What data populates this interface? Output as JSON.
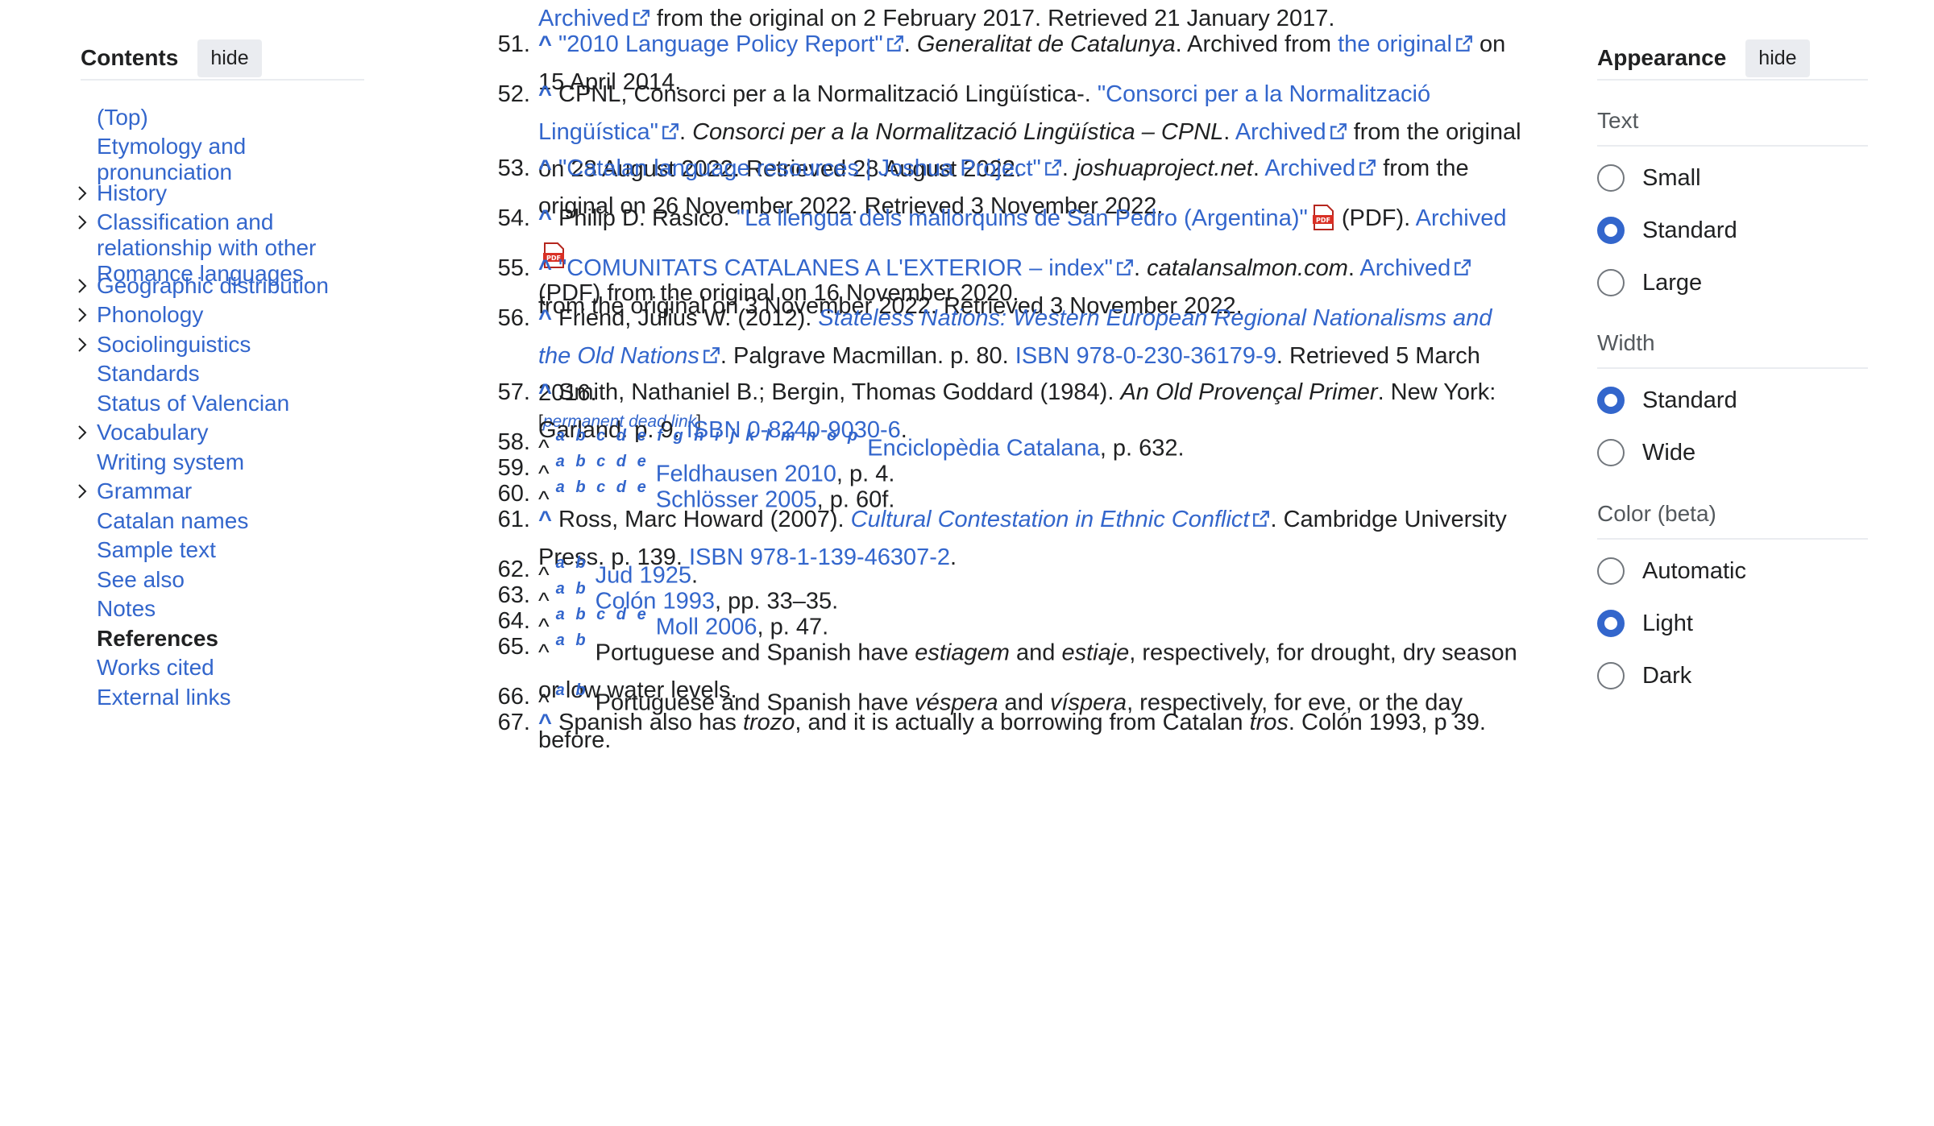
{
  "toc": {
    "title": "Contents",
    "hide_label": "hide",
    "items": [
      {
        "label": "(Top)"
      },
      {
        "label": "Etymology and pronunciation"
      },
      {
        "label": "History"
      },
      {
        "label": "Classification and relationship with other Romance languages"
      },
      {
        "label": "Geographic distribution"
      },
      {
        "label": "Phonology"
      },
      {
        "label": "Sociolinguistics"
      },
      {
        "label": "Standards"
      },
      {
        "label": "Status of Valencian"
      },
      {
        "label": "Vocabulary"
      },
      {
        "label": "Writing system"
      },
      {
        "label": "Grammar"
      },
      {
        "label": "Catalan names"
      },
      {
        "label": "Sample text"
      },
      {
        "label": "See also"
      },
      {
        "label": "Notes"
      },
      {
        "label": "References"
      },
      {
        "label": "Works cited"
      },
      {
        "label": "External links"
      }
    ]
  },
  "refs": {
    "r50": {
      "archived": "Archived",
      "tail": " from the original on 2 February 2017. Retrieved 21 January 2017."
    },
    "r51": {
      "num": "51.",
      "caret": "^",
      "title": "\"2010 Language Policy Report\"",
      "pub": "Generalitat de Catalunya",
      "t1": ". Archived from ",
      "orig": "the original",
      "t2": " on 15 April 2014."
    },
    "r52": {
      "num": "52.",
      "caret": "^",
      "t0": "CPNL, Consorci per a la Normalització Lingüística-. ",
      "title": "\"Consorci per a la Normalització Lingüística\"",
      "pub": "Consorci per a la Normalització Lingüística – CPNL",
      "archived": "Archived",
      "tail": " from the original on 28 August 2022. Retrieved 28 August 2022."
    },
    "r53": {
      "num": "53.",
      "caret": "^",
      "title": "\"Catalan language resources | Joshua Project\"",
      "pub": "joshuaproject.net",
      "archived": "Archived",
      "tail": " from the original on 26 November 2022. Retrieved 3 November 2022."
    },
    "r54": {
      "num": "54.",
      "caret": "^",
      "t0": "Philip D. Rasico. ",
      "title": "\"La llengua dels mallorquins de San Pedro (Argentina)\"",
      "pdf1": " (PDF). ",
      "archived": "Archived",
      "tail": " (PDF) from the original on 16 November 2020."
    },
    "r55": {
      "num": "55.",
      "caret": "^",
      "title": "\"COMUNITATS CATALANES A L'EXTERIOR – index\"",
      "pub": "catalansalmon.com",
      "archived": "Archived",
      "tail": " from the original on 3 November 2022. Retrieved 3 November 2022."
    },
    "r56": {
      "num": "56.",
      "caret": "^",
      "t0": "Friend, Julius W. (2012). ",
      "title": "Stateless Nations: Western European Regional Nationalisms and the Old Nations",
      "t1": ". Palgrave Macmillan. p. 80. ",
      "isbn": "ISBN 978-0-230-36179-9",
      "t2": ". Retrieved 5 March 2016.",
      "dead_open": "[",
      "dead": "permanent dead link",
      "dead_close": "]"
    },
    "r57": {
      "num": "57.",
      "caret": "^",
      "t0": "Smith, Nathaniel B.; Bergin, Thomas Goddard (1984). ",
      "book": "An Old Provençal Primer",
      "t1": ". New York: Garland. p. 9. ",
      "isbn": "ISBN 0-8240-9030-6",
      "t2": "."
    },
    "r58": {
      "num": "58.",
      "caret": "^",
      "sup": "a b c d e f g h i j k l m n o p",
      "link": "Enciclopèdia Catalana",
      "tail": ", p. 632."
    },
    "r59": {
      "num": "59.",
      "caret": "^",
      "sup": "a b c d e",
      "link": "Feldhausen 2010",
      "tail": ", p. 4."
    },
    "r60": {
      "num": "60.",
      "caret": "^",
      "sup": "a b c d e",
      "link": "Schlösser 2005",
      "tail": ", p. 60f."
    },
    "r61": {
      "num": "61.",
      "caret": "^",
      "t0": "Ross, Marc Howard (2007). ",
      "title": "Cultural Contestation in Ethnic Conflict",
      "t1": ". Cambridge University Press. p. 139. ",
      "isbn": "ISBN 978-1-139-46307-2",
      "t2": "."
    },
    "r62": {
      "num": "62.",
      "caret": "^",
      "sup": "a b",
      "link": "Jud 1925",
      "tail": "."
    },
    "r63": {
      "num": "63.",
      "caret": "^",
      "sup": "a b",
      "link": "Colón 1993",
      "tail": ", pp. 33–35."
    },
    "r64": {
      "num": "64.",
      "caret": "^",
      "sup": "a b c d e",
      "link": "Moll 2006",
      "tail": ", p. 47."
    },
    "r65": {
      "num": "65.",
      "caret": "^",
      "sup": "a b",
      "t0": "Portuguese and Spanish have ",
      "w1": "estiagem",
      "t1": " and ",
      "w2": "estiaje",
      "t2": ", respectively, for drought, dry season or low water levels."
    },
    "r66": {
      "num": "66.",
      "caret": "^",
      "sup": "a b",
      "t0": "Portuguese and Spanish have ",
      "w1": "véspera",
      "t1": " and ",
      "w2": "víspera",
      "t2": ", respectively, for eve, or the day before."
    },
    "r67": {
      "num": "67.",
      "caret": "^",
      "t0": "Spanish also has ",
      "w1": "trozo",
      "t1": ", and it is actually a borrowing from Catalan ",
      "w2": "tros",
      "t2": ". Colón 1993, p 39."
    }
  },
  "appearance": {
    "title": "Appearance",
    "hide_label": "hide",
    "text_label": "Text",
    "text_options": [
      "Small",
      "Standard",
      "Large"
    ],
    "text_selected": "Standard",
    "width_label": "Width",
    "width_options": [
      "Standard",
      "Wide"
    ],
    "width_selected": "Standard",
    "color_label": "Color (beta)",
    "color_options": [
      "Automatic",
      "Light",
      "Dark"
    ],
    "color_selected": "Light"
  },
  "colors": {
    "link": "#3366cc",
    "text": "#202122",
    "muted": "#54595d",
    "radio_on": "#3366cc"
  }
}
